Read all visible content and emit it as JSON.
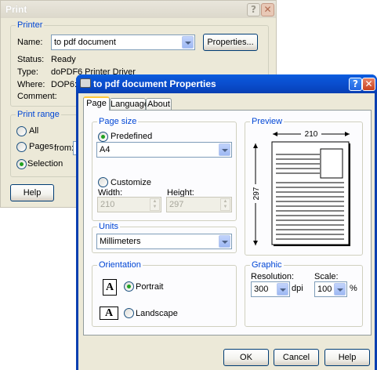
{
  "print_dialog": {
    "title": "Print",
    "printer_group": "Printer",
    "name_label": "Name:",
    "name_value": "to pdf document",
    "properties_button": "Properties...",
    "status_label": "Status:",
    "status_value": "Ready",
    "type_label": "Type:",
    "type_value": "doPDF",
    "type_extra": "6 Printer Driver",
    "where_label": "Where:",
    "where_value": "DOP6:",
    "comment_label": "Comment:",
    "range_group": "Print range",
    "range_all": "All",
    "range_pages": "Pages",
    "range_from": "from:",
    "range_selection": "Selection",
    "help_button": "Help"
  },
  "props_dialog": {
    "title": "to pdf document Properties",
    "tabs": [
      {
        "label": "Page"
      },
      {
        "label": "Language"
      },
      {
        "label": "About"
      }
    ],
    "page_size_group": "Page size",
    "predefined_label": "Predefined",
    "predefined_value": "A4",
    "customize_label": "Customize",
    "width_label": "Width:",
    "width_value": "210",
    "height_label": "Height:",
    "height_value": "297",
    "units_group": "Units",
    "units_value": "Millimeters",
    "orientation_group": "Orientation",
    "portrait_label": "Portrait",
    "landscape_label": "Landscape",
    "orientation_icon_letter": "A",
    "preview_group": "Preview",
    "preview_width": "210",
    "preview_height": "297",
    "graphic_group": "Graphic",
    "resolution_label": "Resolution:",
    "resolution_value": "300",
    "resolution_unit": "dpi",
    "scale_label": "Scale:",
    "scale_value": "100",
    "scale_unit": "%",
    "ok_button": "OK",
    "cancel_button": "Cancel",
    "help_button": "Help"
  },
  "colors": {
    "active_title": "#0a4fd0",
    "dialog_bg": "#ece9d8",
    "group_title": "#0046d5",
    "accent_tab": "#ffc83c"
  }
}
